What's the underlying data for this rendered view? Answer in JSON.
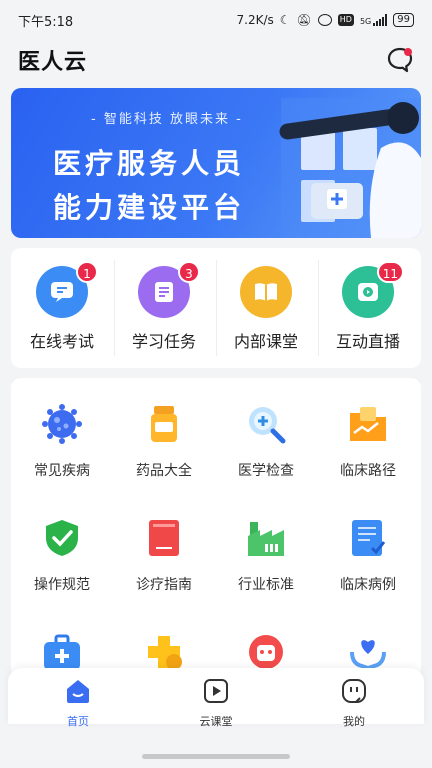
{
  "status_bar": {
    "time": "下午5:18",
    "speed": "7.2K/s",
    "network": "5G",
    "battery": "99"
  },
  "header": {
    "title": "医人云"
  },
  "banner": {
    "tagline": "- 智能科技 放眼未来 -",
    "line1": "医疗服务人员",
    "line2": "能力建设平台"
  },
  "quick_actions": [
    {
      "label": "在线考试",
      "badge": "1",
      "color": "#3b8df5",
      "icon": "exam-icon"
    },
    {
      "label": "学习任务",
      "badge": "3",
      "color": "#9b6bf0",
      "icon": "task-icon"
    },
    {
      "label": "内部课堂",
      "badge": "",
      "color": "#f5b62b",
      "icon": "book-icon"
    },
    {
      "label": "互动直播",
      "badge": "11",
      "color": "#2dbf95",
      "icon": "live-icon"
    }
  ],
  "grid": [
    {
      "label": "常见疾病",
      "icon": "virus-icon"
    },
    {
      "label": "药品大全",
      "icon": "medicine-bottle-icon"
    },
    {
      "label": "医学检查",
      "icon": "magnifier-icon"
    },
    {
      "label": "临床路径",
      "icon": "folder-chart-icon"
    },
    {
      "label": "操作规范",
      "icon": "shield-check-icon"
    },
    {
      "label": "诊疗指南",
      "icon": "guide-book-icon"
    },
    {
      "label": "行业标准",
      "icon": "factory-icon"
    },
    {
      "label": "临床病例",
      "icon": "case-document-icon"
    },
    {
      "label": "",
      "icon": "medical-kit-icon"
    },
    {
      "label": "",
      "icon": "health-cross-icon"
    },
    {
      "label": "",
      "icon": "robot-icon"
    },
    {
      "label": "",
      "icon": "heart-hands-icon"
    }
  ],
  "tabs": [
    {
      "label": "首页",
      "icon": "home-icon",
      "active": true
    },
    {
      "label": "云课堂",
      "icon": "play-icon",
      "active": false
    },
    {
      "label": "我的",
      "icon": "profile-icon",
      "active": false
    }
  ],
  "colors": {
    "accent": "#3a6ef2",
    "badge": "#e8294a"
  }
}
